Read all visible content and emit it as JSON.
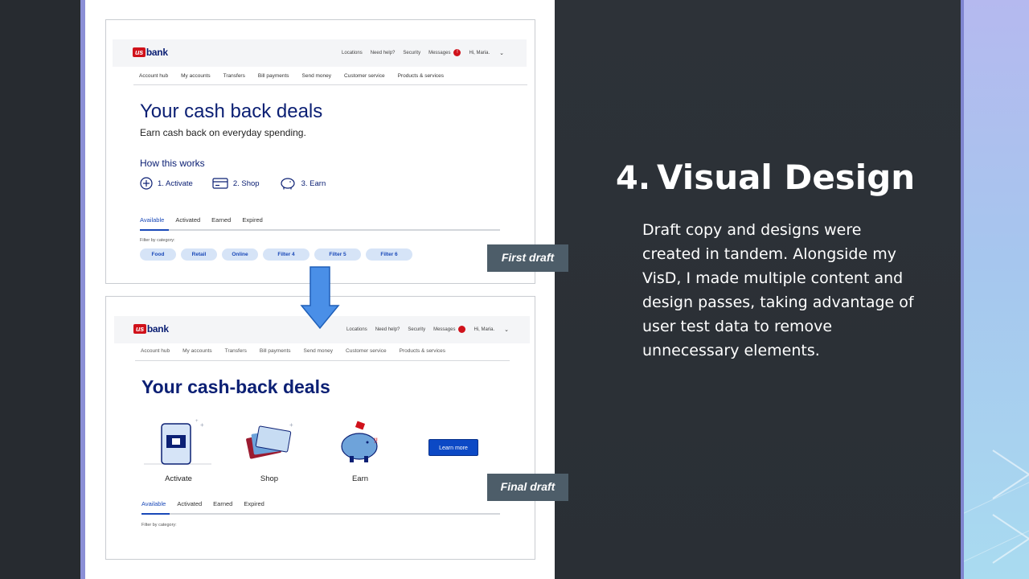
{
  "slide": {
    "heading_number": "4.",
    "heading": "Visual Design",
    "body": "Draft copy and designs were created in tandem. Alongside my VisD, I made multiple content and design passes, taking advantage of user test data to remove unnecessary elements.",
    "tag_first": "First draft",
    "tag_final": "Final draft"
  },
  "mock1": {
    "logo_us": "us",
    "logo_rest": "bank",
    "util": [
      "Locations",
      "Need help?",
      "Security",
      "Messages"
    ],
    "badge": "!",
    "greeting": "Hi, Maria.",
    "nav": [
      "Account hub",
      "My accounts",
      "Transfers",
      "Bill payments",
      "Send money",
      "Customer service",
      "Products & services"
    ],
    "title": "Your cash back deals",
    "subtitle": "Earn cash back on everyday spending.",
    "how": "How this works",
    "steps": [
      "1. Activate",
      "2. Shop",
      "3. Earn"
    ],
    "tabs": [
      "Available",
      "Activated",
      "Earned",
      "Expired"
    ],
    "filter_label": "Filter by category:",
    "chips": [
      "Food",
      "Retail",
      "Online",
      "Filter 4",
      "Filter 5",
      "Filter 6"
    ]
  },
  "mock2": {
    "logo_us": "us",
    "logo_rest": "bank",
    "util": [
      "Locations",
      "Need help?",
      "Security",
      "Messages"
    ],
    "greeting": "Hi, Maria.",
    "nav": [
      "Account hub",
      "My accounts",
      "Transfers",
      "Bill payments",
      "Send money",
      "Customer service",
      "Products & services"
    ],
    "title": "Your cash-back deals",
    "illus": [
      "Activate",
      "Shop",
      "Earn"
    ],
    "learn_more": "Learn more",
    "tabs": [
      "Available",
      "Activated",
      "Earned",
      "Expired"
    ],
    "filter_label": "Filter by category:"
  },
  "colors": {
    "navy": "#0c2074",
    "brand_red": "#d0121b",
    "link_blue": "#1a49b8",
    "tag_bg": "#4d5d69"
  }
}
